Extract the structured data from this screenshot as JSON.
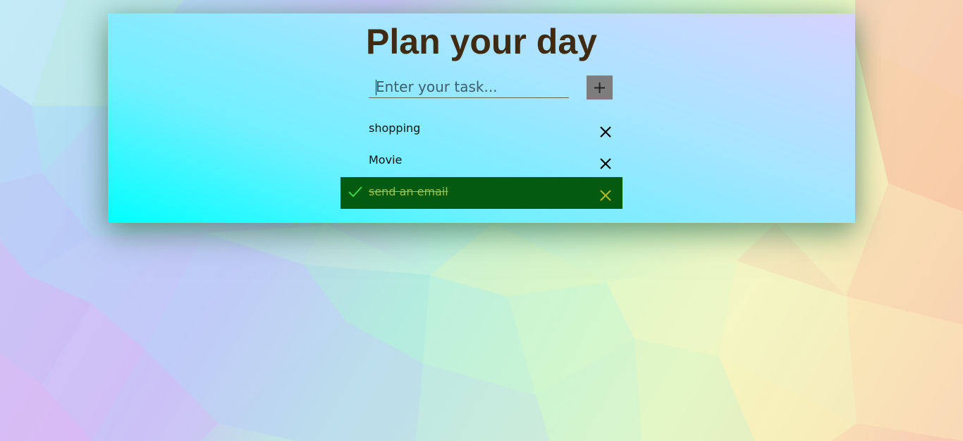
{
  "header": {
    "title": "Plan your day"
  },
  "form": {
    "input_placeholder": "Enter your task...",
    "add_button_label": "+"
  },
  "tasks": [
    {
      "label": "shopping",
      "done": false
    },
    {
      "label": "Movie",
      "done": false
    },
    {
      "label": "send an email",
      "done": true
    }
  ],
  "colors": {
    "title": "#3f2a12",
    "done_background": "#045a0e",
    "done_text": "#9cc04a",
    "add_button": "#7d7d7d"
  },
  "icons": {
    "add": "plus-icon",
    "remove": "close-icon",
    "done": "checkmark-icon"
  }
}
